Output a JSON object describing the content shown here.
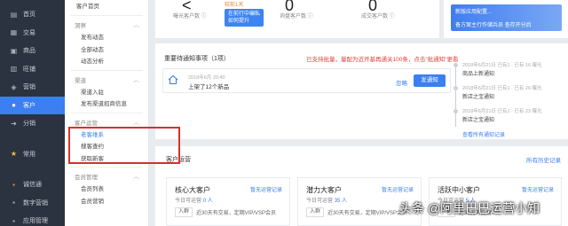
{
  "sidebar": {
    "items": [
      {
        "label": "首页",
        "icon": "home-icon",
        "glyph": "▤"
      },
      {
        "label": "交易",
        "icon": "trade-icon",
        "glyph": "▦"
      },
      {
        "label": "商品",
        "icon": "goods-icon",
        "glyph": "▣"
      },
      {
        "label": "旺铺",
        "icon": "shop-icon",
        "glyph": "▥"
      },
      {
        "label": "营销",
        "icon": "marketing-icon",
        "glyph": "◈"
      },
      {
        "label": "客户",
        "icon": "customer-icon",
        "glyph": "●"
      },
      {
        "label": "分销",
        "icon": "distribution-icon",
        "glyph": "➜"
      },
      {
        "label": "常用",
        "icon": "star-icon",
        "glyph": "★"
      },
      {
        "label": "诚信通",
        "icon": "cxt-icon",
        "glyph": "▪"
      },
      {
        "label": "数字营销",
        "icon": "digital-marketing-icon",
        "glyph": "▪"
      },
      {
        "label": "应用管理",
        "icon": "app-icon",
        "glyph": "▪"
      }
    ]
  },
  "submenu": {
    "home": "客户首页",
    "groups": [
      {
        "title": "洞察",
        "items": [
          "发布动态",
          "全部动态",
          "动态分析"
        ]
      },
      {
        "title": "渠道",
        "items": [
          "渠道入驻",
          "发布渠道招商信息"
        ]
      },
      {
        "title": "客户运营",
        "items": [
          "老客维系",
          "搜客查约",
          "获取新客"
        ]
      },
      {
        "title": "会员管理",
        "items": [
          "会员列表",
          "会员营销"
        ]
      }
    ],
    "selected": "老客维系"
  },
  "stats": {
    "values": [
      "<",
      "0",
      "0"
    ],
    "labels": [
      "曝光客户数 ⓘ",
      "询盘客户数 ⓘ",
      "成交客户数 ⓘ"
    ],
    "tip_top": "较前1天",
    "tip": "在前行中编私\n如何提升"
  },
  "right_panel": {
    "line1": "新版应用配置...",
    "line2": "备方案主行作储兵员  查存开分后"
  },
  "todo": {
    "title": "重要待通知事项（1项）",
    "alert": "已支持批量，量配为近开基再通关100条，点击\"批通知\"更看",
    "row": {
      "date": "2018年6月 20:40",
      "message": "上架了12个新品",
      "ignore": "忽略",
      "notify": "发通知"
    },
    "timeline": [
      {
        "date": "2018年6月21日 已有1 · 已有 16 曝光",
        "text": "商品上新通知"
      },
      {
        "date": "2018年6月21日 已有1 · 已有 26 曝光",
        "text": "新店之宝通知"
      },
      {
        "date": "2018年6月21日 已有1 · 已有 23 曝光",
        "text": "新店之宝通知"
      }
    ],
    "more": "查看所有通知记录"
  },
  "customer_ops": {
    "title": "客户运营",
    "all_label": "所有历史记录",
    "cards": [
      {
        "name": "核心大客户",
        "record": "暂无运营记录",
        "added_prefix": "今日可运营",
        "added_count": "0 人",
        "tag": "入群",
        "desc": "近30天有交易，定期VIP/VSP会员"
      },
      {
        "name": "潜力大客户",
        "record": "暂无运营记录",
        "added_prefix": "今日可运营",
        "added_count": "35 人",
        "tag": "入群",
        "desc": "近30天有交易，定期VIP/VSP会员"
      },
      {
        "name": "活跃中小客户",
        "record": "暂无运营记录",
        "added_prefix": "今日可运营",
        "added_count": "5 人",
        "tag": "入群",
        "desc": "近30天有交易"
      }
    ]
  },
  "watermark": "头条 @阿里巴巴运营小知",
  "colors": {
    "accent": "#3b7ff0",
    "sidebar": "#2b3340",
    "highlight": "#d53030"
  }
}
